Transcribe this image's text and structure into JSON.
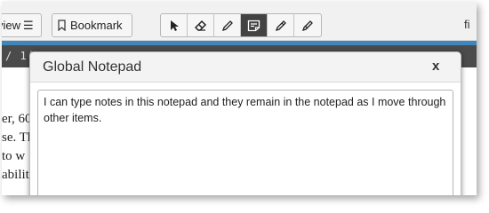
{
  "toolbar": {
    "view_label": "view",
    "view_icon": "list-icon",
    "bookmark_label": "Bookmark",
    "bookmark_icon": "bookmark-icon",
    "tools": [
      {
        "icon": "pointer-icon",
        "active": false
      },
      {
        "icon": "eraser-icon",
        "active": false
      },
      {
        "icon": "pencil-icon",
        "active": false
      },
      {
        "icon": "notepad-icon",
        "active": true
      },
      {
        "icon": "highlighter-icon",
        "active": false
      },
      {
        "icon": "strikethrough-pen-icon",
        "active": false
      }
    ],
    "right_text": "fi"
  },
  "breadcrumb": "/ 1(",
  "document": {
    "lines": [
      "er, 60",
      "se. Th",
      " to w",
      "ability"
    ]
  },
  "dialog": {
    "title": "Global Notepad",
    "close_label": "x",
    "notepad_text": "I can type notes in this notepad and they remain in the notepad as I move through other items."
  },
  "colors": {
    "accent_bar": "#3f86bd",
    "active_tool": "#434343",
    "dark_strip": "#4b4b4b"
  }
}
